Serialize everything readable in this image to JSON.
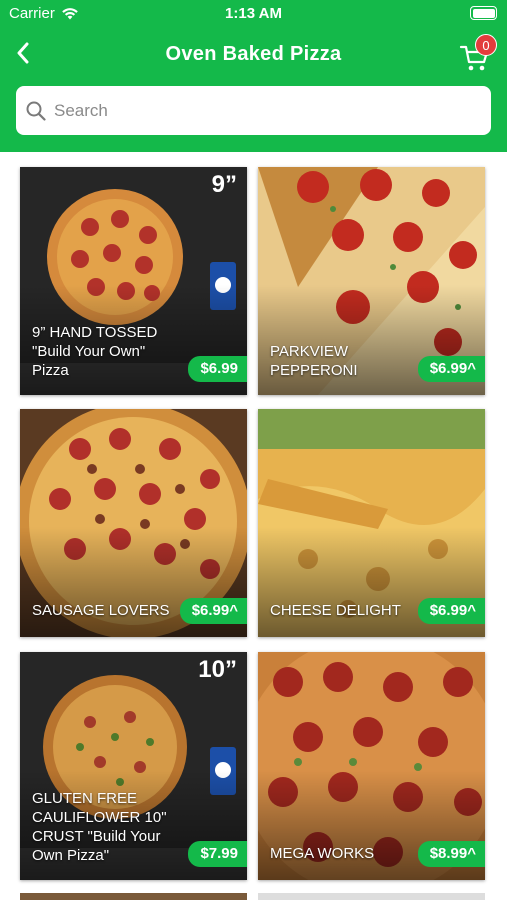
{
  "status_bar": {
    "carrier": "Carrier",
    "time": "1:13 AM"
  },
  "header": {
    "title": "Oven Baked Pizza",
    "cart_count": "0"
  },
  "search": {
    "placeholder": "Search"
  },
  "items": [
    {
      "name": "9” HAND TOSSED \"Build Your Own\" Pizza",
      "price": "$6.99",
      "size": "9”"
    },
    {
      "name": "PARKVIEW PEPPERONI",
      "price": "$6.99^"
    },
    {
      "name": "SAUSAGE LOVERS",
      "price": "$6.99^"
    },
    {
      "name": "CHEESE DELIGHT",
      "price": "$6.99^"
    },
    {
      "name": "GLUTEN FREE CAULIFLOWER 10\" CRUST \"Build Your Own Pizza\"",
      "price": "$7.99",
      "size": "10”"
    },
    {
      "name": "MEGA WORKS",
      "price": "$8.99^"
    }
  ],
  "colors": {
    "brand": "#14b94a",
    "badge": "#e23c3c"
  }
}
